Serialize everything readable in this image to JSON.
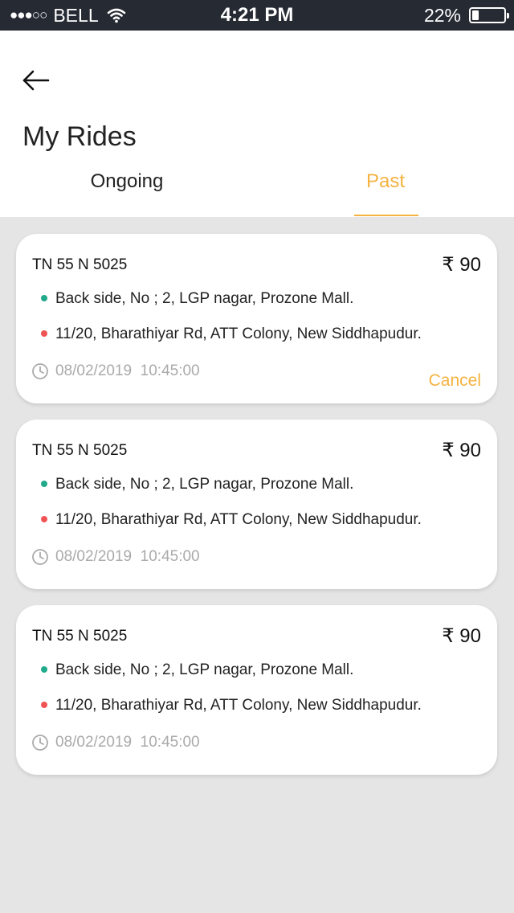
{
  "status_bar": {
    "signal": "●●●○○",
    "carrier": "BELL",
    "time": "4:21 PM",
    "battery_text": "22%",
    "battery_level": 0.22
  },
  "header": {
    "back_icon": "arrow-left-icon",
    "title": "My Rides"
  },
  "tabs": [
    {
      "label": "Ongoing",
      "active": false
    },
    {
      "label": "Past",
      "active": true
    }
  ],
  "colors": {
    "accent": "#f5b240",
    "pickup_dot": "#20a98a",
    "drop_dot": "#ef5454",
    "status_bar": "#262a33",
    "background": "#e5e5e5"
  },
  "rides": [
    {
      "vehicle": "TN 55 N 5025",
      "fare": "₹ 90",
      "pickup": "Back side, No ; 2, LGP nagar, Prozone Mall.",
      "drop": "11/20, Bharathiyar Rd, ATT Colony, New Siddhapudur.",
      "datetime": "08/02/2019  10:45:00",
      "cancel_label": "Cancel"
    },
    {
      "vehicle": "TN 55 N 5025",
      "fare": "₹ 90",
      "pickup": "Back side, No ; 2, LGP nagar, Prozone Mall.",
      "drop": "11/20, Bharathiyar Rd, ATT Colony, New Siddhapudur.",
      "datetime": "08/02/2019  10:45:00"
    },
    {
      "vehicle": "TN 55 N 5025",
      "fare": "₹ 90",
      "pickup": "Back side, No ; 2, LGP nagar, Prozone Mall.",
      "drop": "11/20, Bharathiyar Rd, ATT Colony, New Siddhapudur.",
      "datetime": "08/02/2019  10:45:00"
    }
  ]
}
